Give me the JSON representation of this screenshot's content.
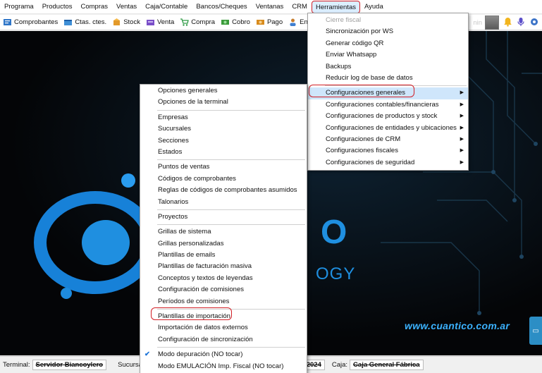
{
  "menubar": {
    "items": [
      "Programa",
      "Productos",
      "Compras",
      "Ventas",
      "Caja/Contable",
      "Bancos/Cheques",
      "Ventanas",
      "CRM",
      "Herramientas",
      "Ayuda"
    ]
  },
  "toolbar": {
    "items": [
      {
        "label": "Comprobantes",
        "icon": "receipt-icon"
      },
      {
        "label": "Ctas. ctes.",
        "icon": "accounts-icon"
      },
      {
        "label": "Stock",
        "icon": "box-icon"
      },
      {
        "label": "Venta",
        "icon": "sale-icon"
      },
      {
        "label": "Compra",
        "icon": "cart-icon"
      },
      {
        "label": "Cobro",
        "icon": "money-icon"
      },
      {
        "label": "Pago",
        "icon": "payment-icon"
      },
      {
        "label": "Entid",
        "icon": "entity-icon"
      }
    ],
    "faded_text": "nin"
  },
  "tools_menu": {
    "items": [
      "Cierre fiscal",
      "Sincronización por WS",
      "Generar código QR",
      "Enviar Whatsapp",
      "Backups",
      "Reducir log de base de datos"
    ],
    "submenus": [
      "Configuraciones generales",
      "Configuraciones contables/financieras",
      "Configuraciones de productos y stock",
      "Configuraciones de entidades y ubicaciones",
      "Configuraciones de CRM",
      "Configuraciones fiscales",
      "Configuraciones de seguridad"
    ]
  },
  "config_menu": {
    "g1": [
      "Opciones generales",
      "Opciones de la terminal"
    ],
    "g2": [
      "Empresas",
      "Sucursales",
      "Secciones",
      "Estados"
    ],
    "g3": [
      "Puntos de ventas",
      "Códigos de comprobantes",
      "Reglas de códigos de comprobantes asumidos",
      "Talonarios"
    ],
    "g4": [
      "Proyectos"
    ],
    "g5": [
      "Grillas de sistema",
      "Grillas personalizadas",
      "Plantillas de emails",
      "Plantillas de facturación masiva",
      "Conceptos y textos de leyendas",
      "Configuración de comisiones",
      "Períodos de comisiones"
    ],
    "g6": [
      "Plantillas de importación",
      "Importación de datos externos",
      "Configuración de sincronización"
    ],
    "g7": [
      "Modo depuración (NO tocar)",
      "Modo EMULACIÓN Imp. Fiscal (NO tocar)"
    ]
  },
  "splash": {
    "brand_fragment": "O",
    "tagline_fragment": "OGY",
    "website": "www.cuantico.com.ar"
  },
  "statusbar": {
    "terminal_label": "Terminal:",
    "terminal_value": "Servidor Biancoylero",
    "sucursal_label": "Sucursal:",
    "year_value": "2024",
    "caja_label": "Caja:",
    "caja_value": "Caja General Fábrica"
  },
  "colors": {
    "accent_red": "#d21f26",
    "highlight": "#cfe6fb",
    "brand_blue": "#1f8fe0"
  }
}
